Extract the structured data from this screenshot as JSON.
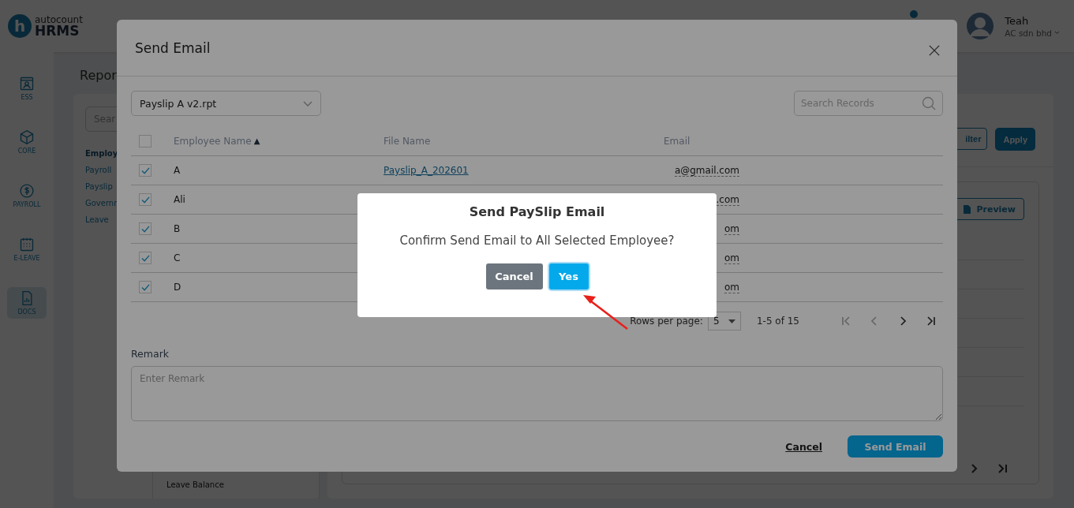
{
  "header": {
    "logo_letter": "h",
    "logo_small": "autocount",
    "logo_big": "HRMS",
    "user": {
      "name": "Teah",
      "company": "AC sdn bhd"
    }
  },
  "rail": [
    {
      "label": "ESS",
      "kind": "card",
      "selected": false
    },
    {
      "label": "CORE",
      "kind": "cube",
      "selected": false
    },
    {
      "label": "PAYROLL",
      "kind": "coin",
      "selected": false
    },
    {
      "label": "E-LEAVE",
      "kind": "calendar",
      "selected": false
    },
    {
      "label": "DOCS",
      "kind": "document",
      "selected": true
    }
  ],
  "page": {
    "title": "Repor",
    "search_placeholder": "Sear",
    "categories": [
      {
        "label": "Employ",
        "selected": true
      },
      {
        "label": "Payroll",
        "selected": false
      },
      {
        "label": "Payslip",
        "selected": false
      },
      {
        "label": "Governn",
        "selected": false
      },
      {
        "label": "Leave",
        "selected": false
      }
    ],
    "reports": [
      "Leave Balance"
    ],
    "filter_button": "ilter",
    "apply_button": "Apply",
    "preview_button": "Preview"
  },
  "send_email_dialog": {
    "title": "Send Email",
    "template": "Payslip A v2.rpt",
    "search_placeholder": "Search Records",
    "all_checked": false,
    "columns": [
      {
        "label": "Employee Name",
        "sort_indicator": "▲"
      },
      {
        "label": "File Name"
      },
      {
        "label": "Email"
      }
    ],
    "rows": [
      {
        "checked": true,
        "name": "A",
        "file": "Payslip_A_202601",
        "email": "a@gmail.com"
      },
      {
        "checked": true,
        "name": "Ali",
        "email": ".com"
      },
      {
        "checked": true,
        "name": "B",
        "email": "om"
      },
      {
        "checked": true,
        "name": "C",
        "email": "om"
      },
      {
        "checked": true,
        "name": "D",
        "email": "om"
      }
    ],
    "pagination": {
      "rows_per_page_label": "Rows per page:",
      "rows_per_page": "5",
      "range": "1-5 of 15",
      "buttons": [
        {
          "kind": "first",
          "disabled": true
        },
        {
          "kind": "prev",
          "disabled": true
        },
        {
          "kind": "next",
          "disabled": false
        },
        {
          "kind": "last",
          "disabled": false
        }
      ]
    },
    "remark": {
      "label": "Remark",
      "placeholder": "Enter Remark"
    },
    "cancel_button": "Cancel",
    "send_button": "Send Email"
  },
  "confirm_dialog": {
    "title": "Send PaySlip Email",
    "message": "Confirm Send Email to All Selected Employee?",
    "cancel_button": "Cancel",
    "confirm_button": "Yes",
    "confirm_focused": true
  }
}
